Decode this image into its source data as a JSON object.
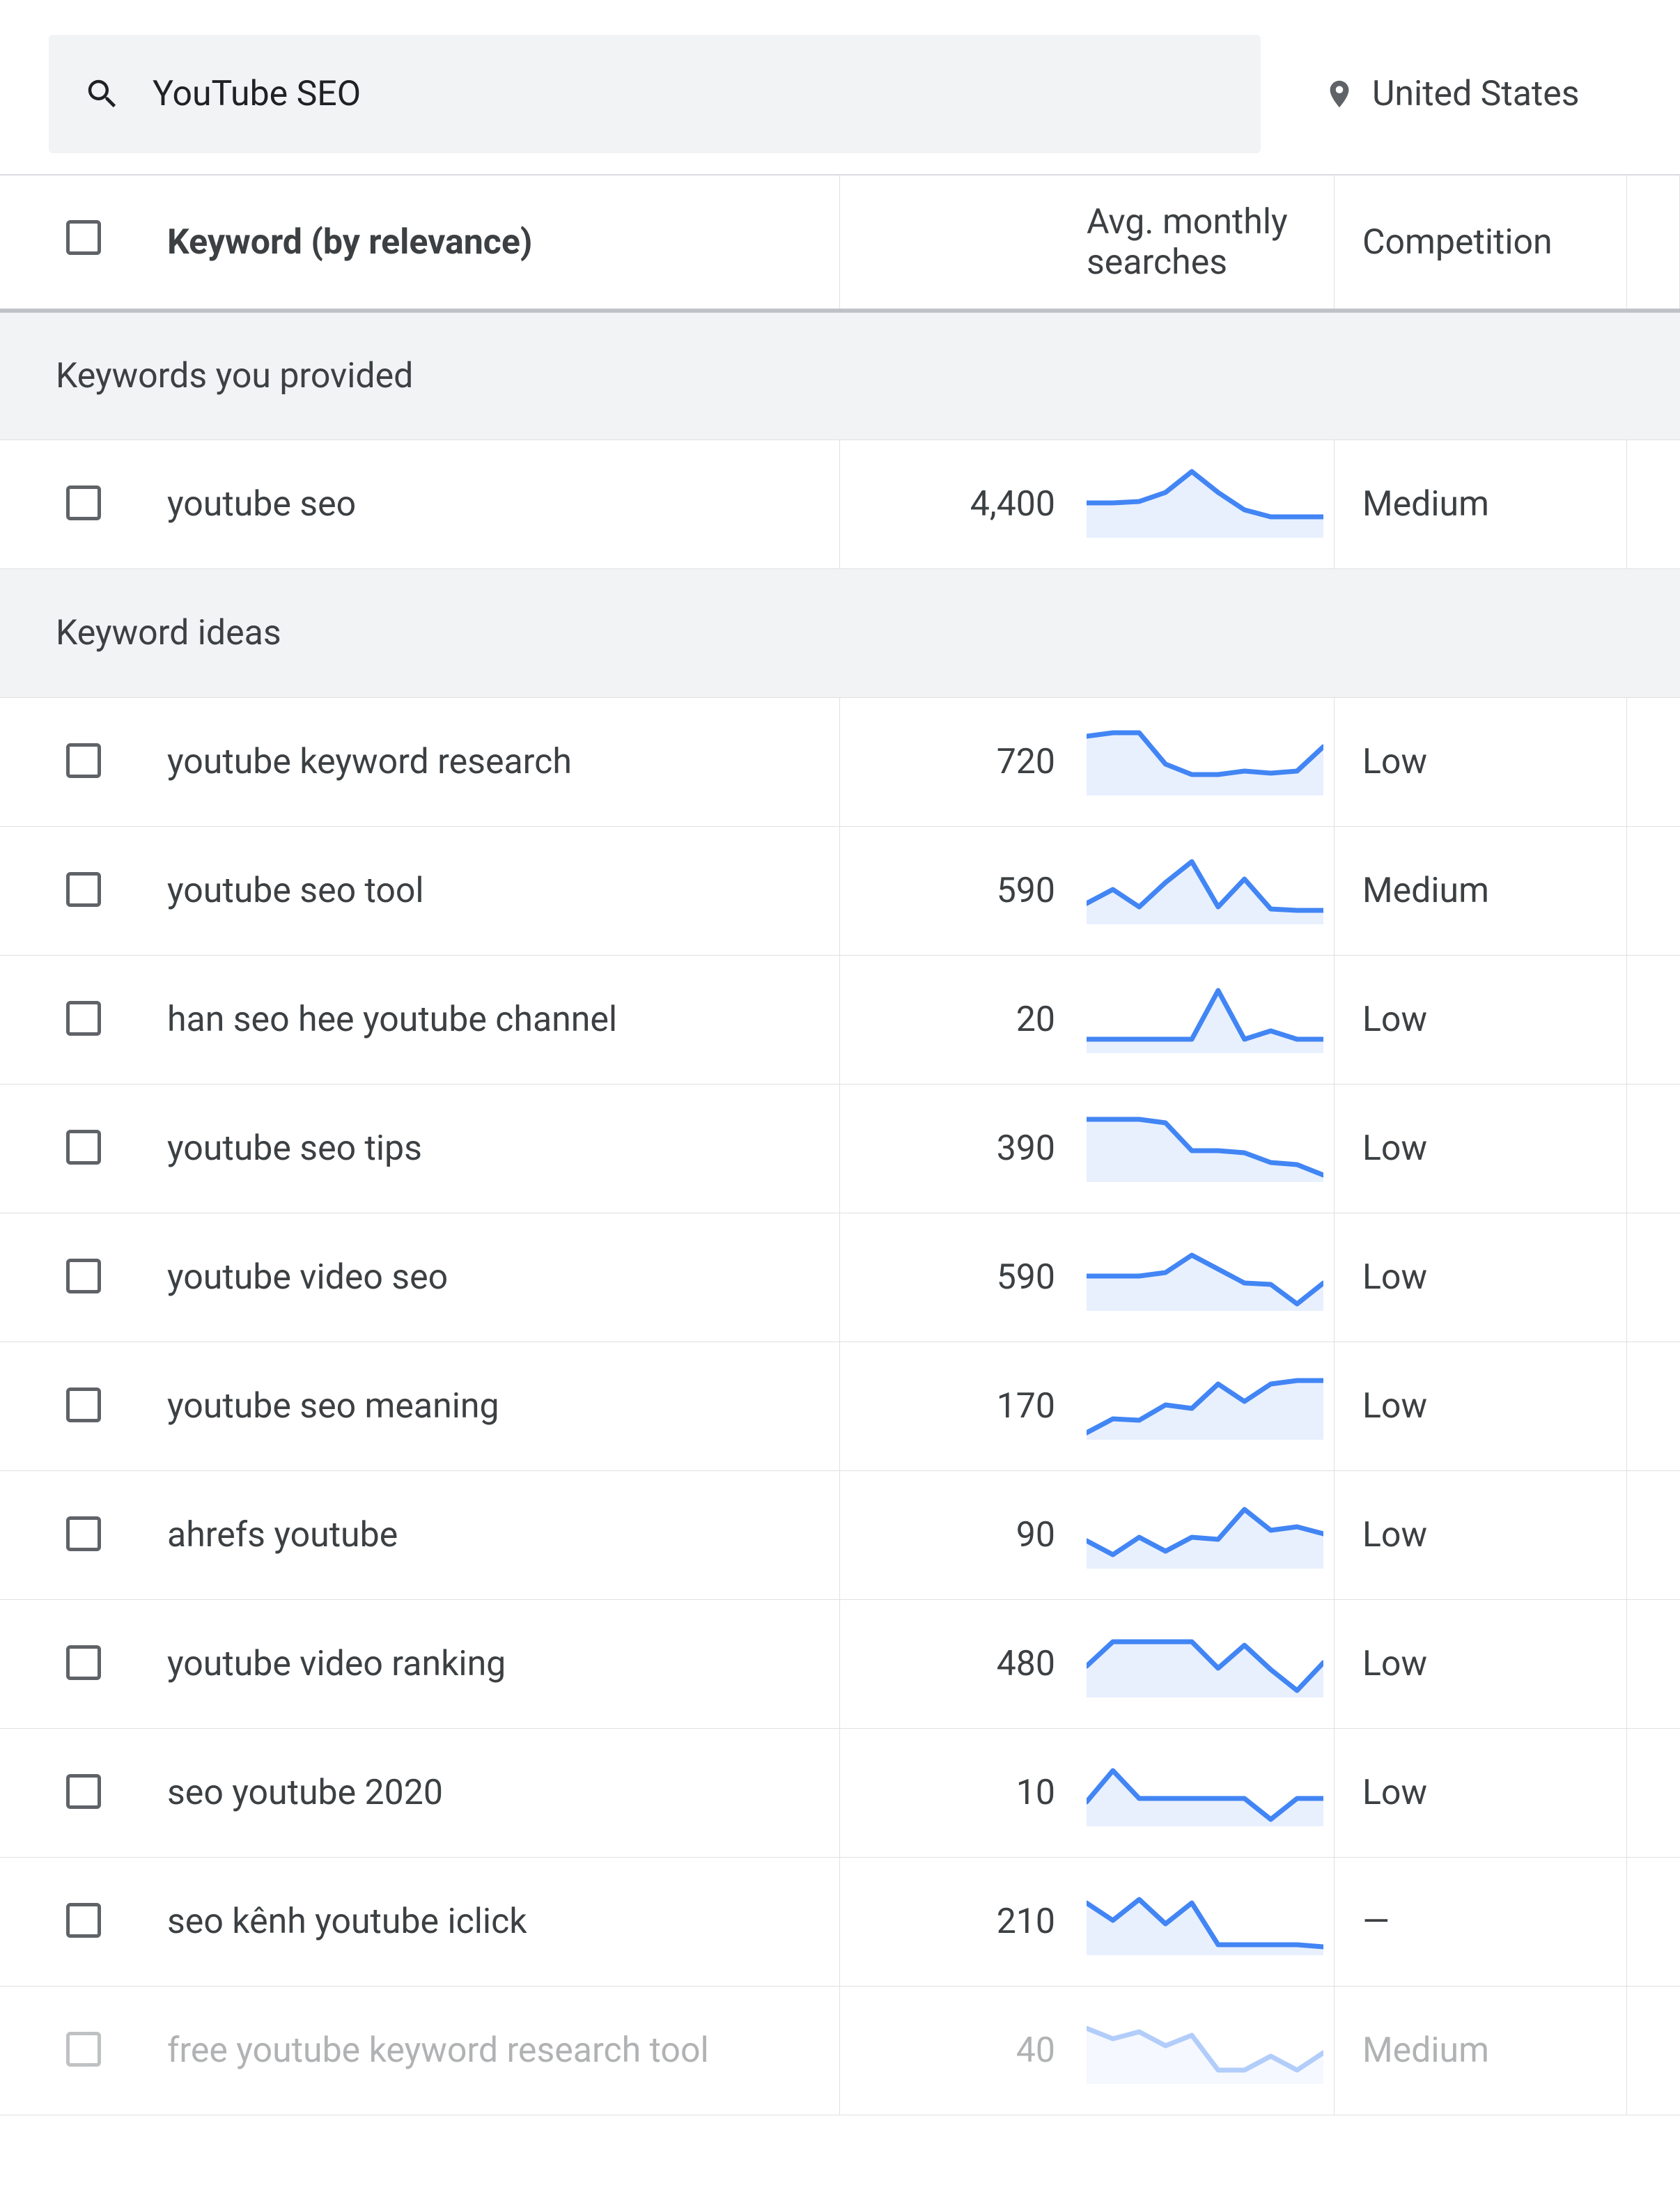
{
  "search": {
    "query": "YouTube SEO"
  },
  "location": {
    "label": "United States"
  },
  "columns": {
    "keyword": "Keyword (by relevance)",
    "searches": "Avg. monthly searches",
    "competition": "Competition"
  },
  "sections": {
    "provided": "Keywords you provided",
    "ideas": "Keyword ideas"
  },
  "provided": [
    {
      "keyword": "youtube seo",
      "searches": "4,400",
      "competition": "Medium",
      "spark": [
        50,
        50,
        48,
        35,
        5,
        35,
        60,
        70,
        70,
        70
      ],
      "faded": false
    }
  ],
  "ideas": [
    {
      "keyword": "youtube keyword research",
      "searches": "720",
      "competition": "Low",
      "spark": [
        15,
        10,
        10,
        55,
        70,
        70,
        65,
        68,
        65,
        30
      ],
      "faded": false
    },
    {
      "keyword": "youtube seo tool",
      "searches": "590",
      "competition": "Medium",
      "spark": [
        70,
        50,
        75,
        40,
        10,
        75,
        35,
        78,
        80,
        80
      ],
      "faded": false
    },
    {
      "keyword": "han seo hee youtube channel",
      "searches": "20",
      "competition": "Low",
      "spark": [
        80,
        80,
        80,
        80,
        80,
        10,
        80,
        68,
        80,
        80
      ],
      "faded": false
    },
    {
      "keyword": "youtube seo tips",
      "searches": "390",
      "competition": "Low",
      "spark": [
        10,
        10,
        10,
        15,
        55,
        55,
        58,
        72,
        75,
        90
      ],
      "faded": false
    },
    {
      "keyword": "youtube video seo",
      "searches": "590",
      "competition": "Low",
      "spark": [
        50,
        50,
        50,
        45,
        20,
        40,
        60,
        62,
        90,
        60
      ],
      "faded": false
    },
    {
      "keyword": "youtube seo meaning",
      "searches": "170",
      "competition": "Low",
      "spark": [
        90,
        70,
        72,
        50,
        55,
        20,
        45,
        20,
        15,
        15
      ],
      "faded": false
    },
    {
      "keyword": "ahrefs youtube",
      "searches": "90",
      "competition": "Low",
      "spark": [
        60,
        80,
        55,
        75,
        55,
        58,
        15,
        45,
        40,
        50
      ],
      "faded": false
    },
    {
      "keyword": "youtube video ranking",
      "searches": "480",
      "competition": "Low",
      "spark": [
        55,
        20,
        20,
        20,
        20,
        58,
        25,
        60,
        90,
        50
      ],
      "faded": false
    },
    {
      "keyword": "seo youtube 2020",
      "searches": "10",
      "competition": "Low",
      "spark": [
        65,
        20,
        60,
        60,
        60,
        60,
        60,
        90,
        60,
        60
      ],
      "faded": false
    },
    {
      "keyword": "seo kênh youtube iclick",
      "searches": "210",
      "competition": "—",
      "spark": [
        25,
        50,
        20,
        55,
        25,
        85,
        85,
        85,
        85,
        88
      ],
      "faded": false
    },
    {
      "keyword": "free youtube keyword research tool",
      "searches": "40",
      "competition": "Medium",
      "spark": [
        20,
        35,
        25,
        45,
        30,
        80,
        80,
        60,
        80,
        55
      ],
      "faded": true
    }
  ]
}
